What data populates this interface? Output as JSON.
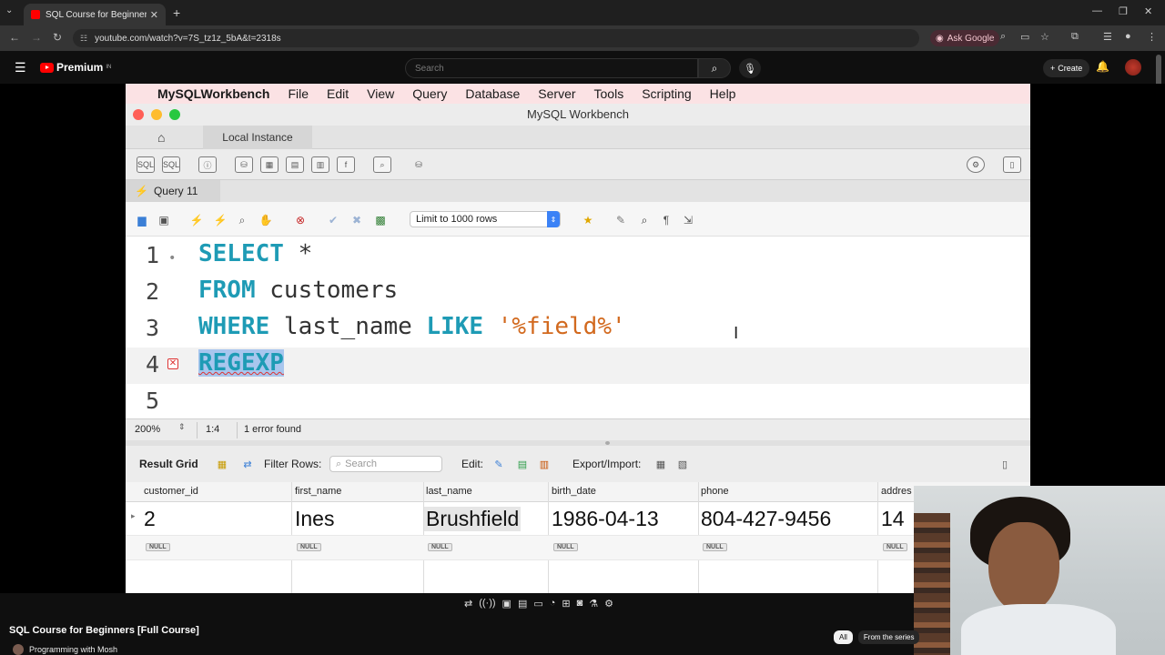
{
  "browser": {
    "tab_title": "SQL Course for Beginners [F",
    "url": "youtube.com/watch?v=7S_tz1z_5bA&t=2318s",
    "ask_google": "Ask Google"
  },
  "youtube": {
    "logo": "Premium",
    "logo_sup": "IN",
    "search_placeholder": "Search",
    "create": "Create",
    "video_title": "SQL Course for Beginners [Full Course]",
    "channel": "Programming with Mosh",
    "chips": [
      "All",
      "From the series"
    ]
  },
  "workbench": {
    "menu": {
      "app": "MySQLWorkbench",
      "items": [
        "File",
        "Edit",
        "View",
        "Query",
        "Database",
        "Server",
        "Tools",
        "Scripting",
        "Help"
      ]
    },
    "window_title": "MySQL Workbench",
    "connection_tab": "Local Instance",
    "query_tab": "Query 11",
    "limit": "Limit to 1000 rows",
    "editor": {
      "line_numbers": [
        "1",
        "2",
        "3",
        "4",
        "5"
      ],
      "line1_kw": "SELECT",
      "line1_rest": " *",
      "line2_kw": "FROM",
      "line2_rest": " customers",
      "line3_kw1": "WHERE",
      "line3_mid": " last_name ",
      "line3_kw2": "LIKE",
      "line3_str": "'%field%'",
      "line4_sel": "REGEXP"
    },
    "status": {
      "zoom": "200%",
      "position": "1:4",
      "errors": "1 error found"
    },
    "result_toolbar": {
      "result_grid": "Result Grid",
      "filter_rows": "Filter Rows:",
      "search_placeholder": "Search",
      "edit": "Edit:",
      "export_import": "Export/Import:"
    },
    "grid": {
      "columns": [
        "customer_id",
        "first_name",
        "last_name",
        "birth_date",
        "phone",
        "addres"
      ],
      "row": [
        "2",
        "Ines",
        "Brushfield",
        "1986-04-13",
        "804-427-9456",
        "14"
      ],
      "null_label": "NULL"
    }
  },
  "colors": {
    "keyword": "#1e9bb5",
    "string": "#d2691e",
    "selection": "#a8c6ee",
    "menu_bg": "#fbe2e4"
  }
}
